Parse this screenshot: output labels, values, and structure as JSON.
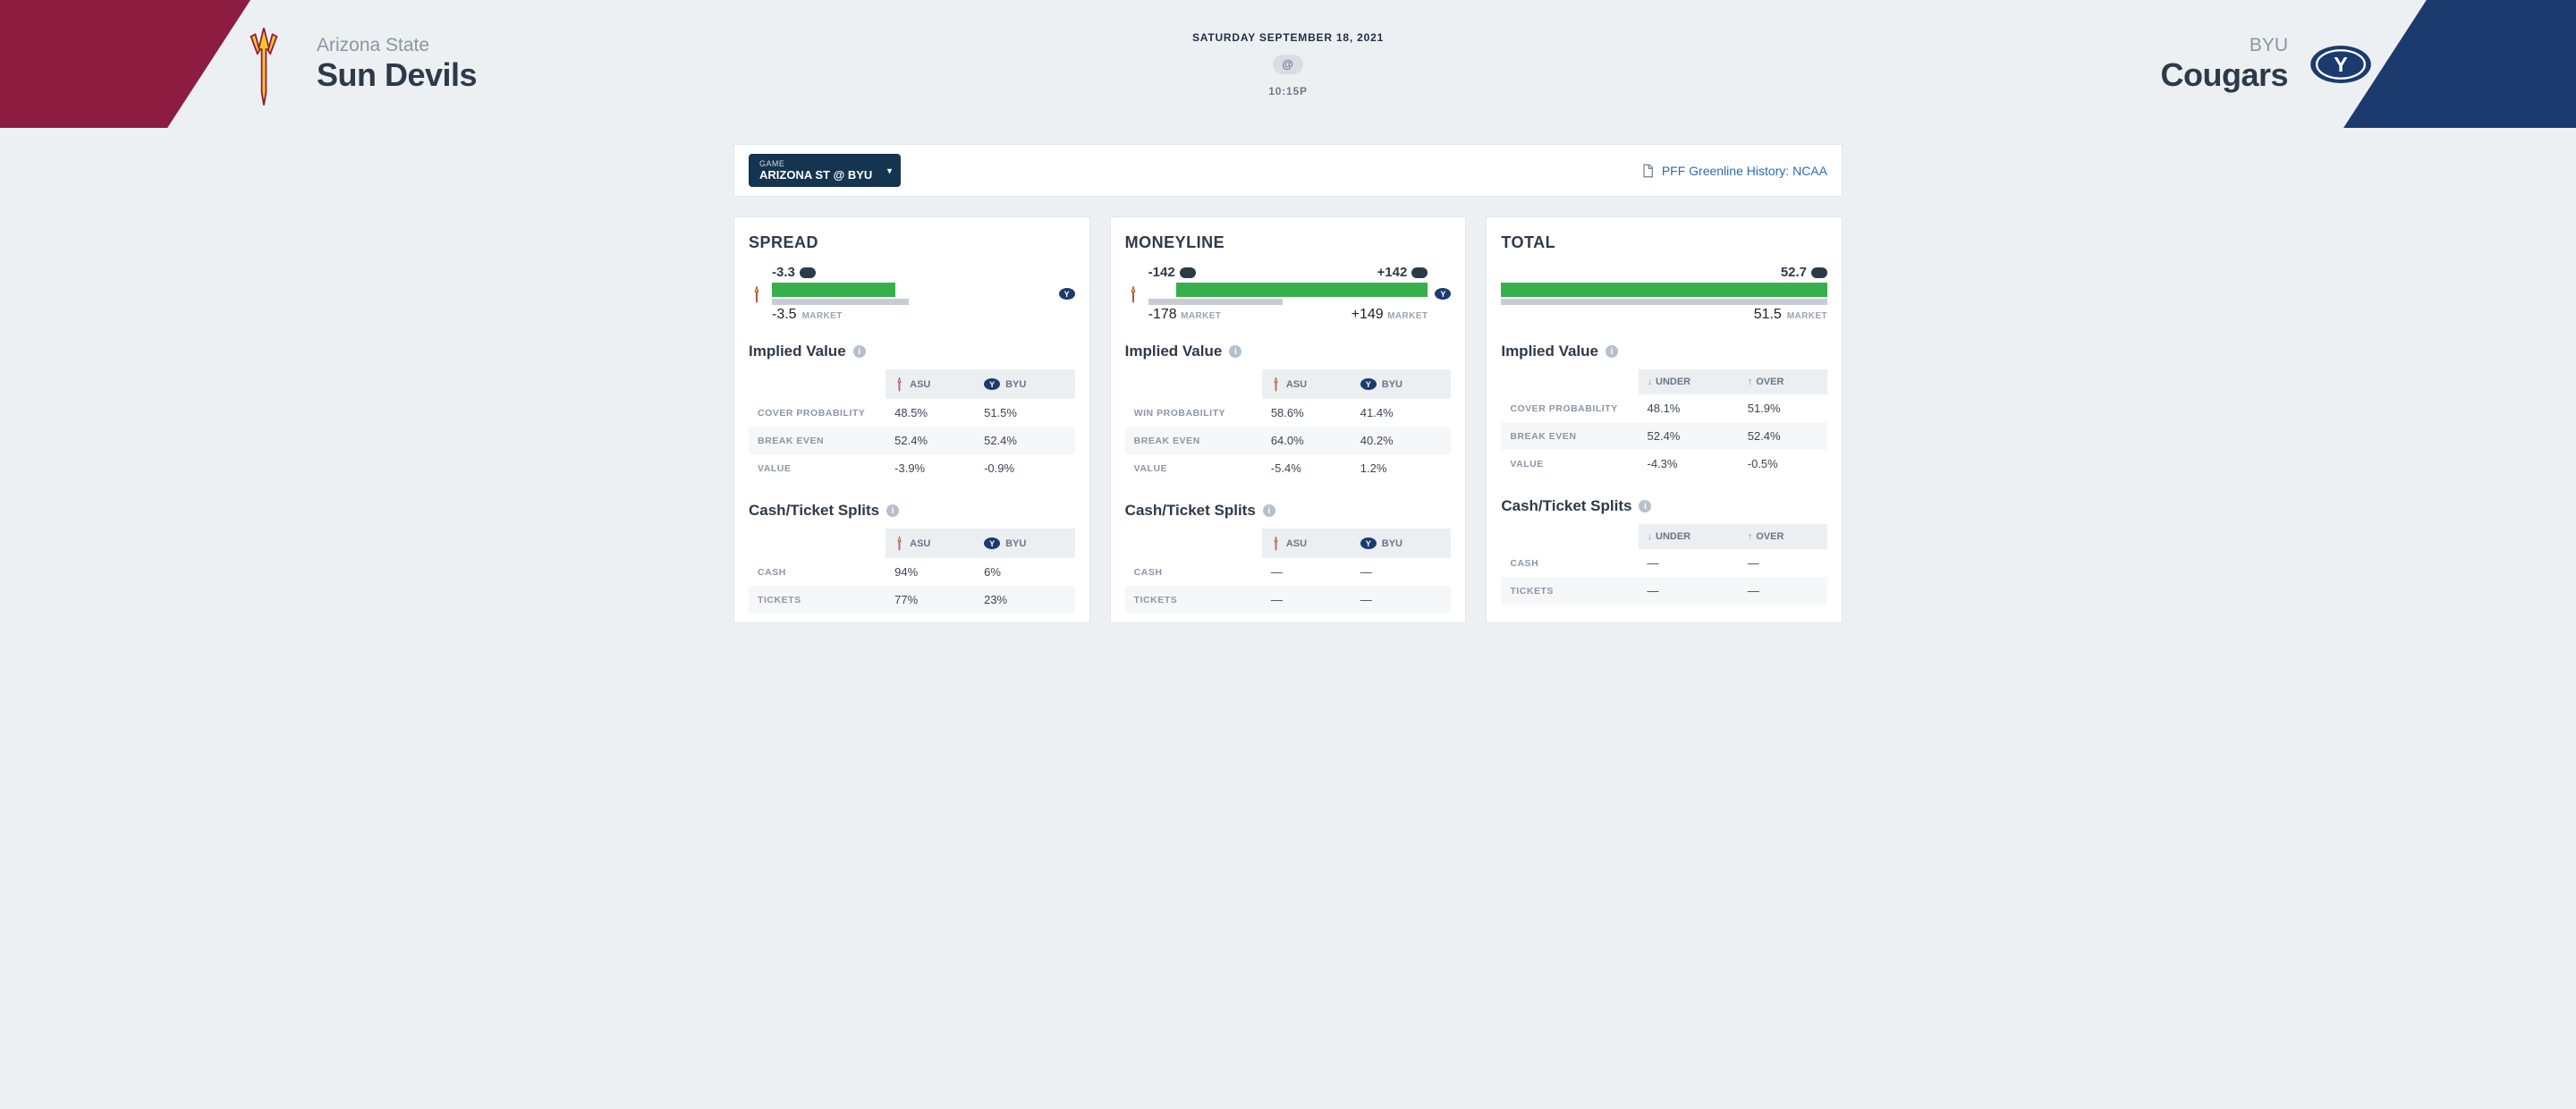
{
  "hero": {
    "date": "SATURDAY SEPTEMBER 18, 2021",
    "at": "@",
    "time": "10:15P"
  },
  "away": {
    "school": "Arizona State",
    "name": "Sun Devils",
    "abbr": "ASU"
  },
  "home": {
    "school": "BYU",
    "name": "Cougars",
    "abbr": "BYU"
  },
  "toolbar": {
    "game_label": "GAME",
    "game_value": "ARIZONA ST @ BYU",
    "history_link": "PFF Greenline History: NCAA"
  },
  "labels": {
    "market": "MARKET",
    "implied_value": "Implied Value",
    "cash_ticket": "Cash/Ticket Splits",
    "cover_prob": "COVER PROBABILITY",
    "win_prob": "WIN PROBABILITY",
    "break_even": "BREAK EVEN",
    "value": "VALUE",
    "cash": "CASH",
    "tickets": "TICKETS",
    "under": "UNDER",
    "over": "OVER"
  },
  "cards": {
    "spread": {
      "title": "SPREAD",
      "pick": "-3.3",
      "market": "-3.5",
      "iv": {
        "cover": {
          "asu": "48.5%",
          "byu": "51.5%"
        },
        "be": {
          "asu": "52.4%",
          "byu": "52.4%"
        },
        "val": {
          "asu": "-3.9%",
          "byu": "-0.9%"
        }
      },
      "splits": {
        "cash": {
          "asu": "94%",
          "byu": "6%"
        },
        "tickets": {
          "asu": "77%",
          "byu": "23%"
        }
      }
    },
    "moneyline": {
      "title": "MONEYLINE",
      "pick_asu": "-142",
      "pick_byu": "+142",
      "market_asu": "-178",
      "market_byu": "+149",
      "iv": {
        "win": {
          "asu": "58.6%",
          "byu": "41.4%"
        },
        "be": {
          "asu": "64.0%",
          "byu": "40.2%"
        },
        "val": {
          "asu": "-5.4%",
          "byu": "1.2%"
        }
      },
      "splits": {
        "cash": {
          "asu": "—",
          "byu": "—"
        },
        "tickets": {
          "asu": "—",
          "byu": "—"
        }
      }
    },
    "total": {
      "title": "TOTAL",
      "pick": "52.7",
      "market": "51.5",
      "iv": {
        "cover": {
          "under": "48.1%",
          "over": "51.9%"
        },
        "be": {
          "under": "52.4%",
          "over": "52.4%"
        },
        "val": {
          "under": "-4.3%",
          "over": "-0.5%"
        }
      },
      "splits": {
        "cash": {
          "under": "—",
          "over": "—"
        },
        "tickets": {
          "under": "—",
          "over": "—"
        }
      }
    }
  }
}
